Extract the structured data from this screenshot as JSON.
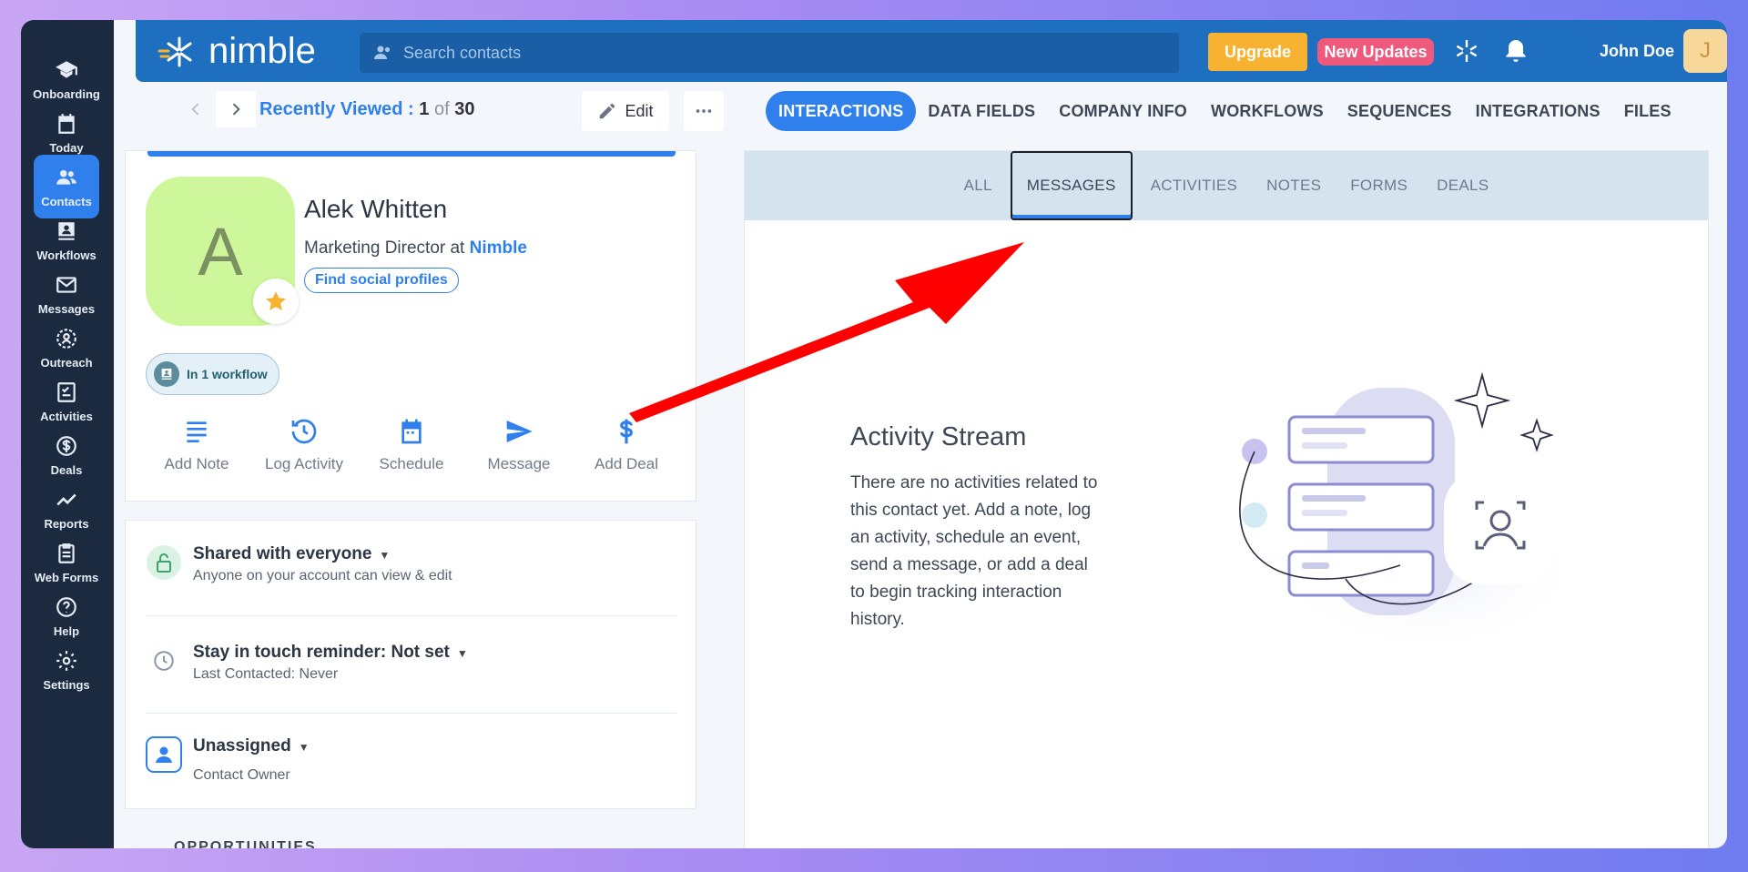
{
  "sidebar": {
    "items": [
      {
        "label": "Onboarding",
        "icon": "graduation-cap-icon"
      },
      {
        "label": "Today",
        "icon": "calendar-icon"
      },
      {
        "label": "Contacts",
        "icon": "people-icon",
        "active": true
      },
      {
        "label": "Workflows",
        "icon": "workflow-icon"
      },
      {
        "label": "Messages",
        "icon": "envelope-icon"
      },
      {
        "label": "Outreach",
        "icon": "outreach-icon"
      },
      {
        "label": "Activities",
        "icon": "checklist-icon"
      },
      {
        "label": "Deals",
        "icon": "dollar-circle-icon"
      },
      {
        "label": "Reports",
        "icon": "trend-icon"
      },
      {
        "label": "Web Forms",
        "icon": "clipboard-icon"
      },
      {
        "label": "Help",
        "icon": "question-icon"
      },
      {
        "label": "Settings",
        "icon": "gear-icon"
      }
    ]
  },
  "header": {
    "logo_text": "nimble",
    "search_placeholder": "Search contacts",
    "upgrade_label": "Upgrade",
    "updates_label": "New Updates",
    "user_name": "John Doe",
    "user_initial": "J"
  },
  "nav": {
    "recent_label": "Recently Viewed :",
    "current": "1",
    "of": "of",
    "total": "30",
    "edit_label": "Edit"
  },
  "main_tabs": [
    {
      "label": "INTERACTIONS",
      "active": true
    },
    {
      "label": "DATA FIELDS"
    },
    {
      "label": "COMPANY INFO"
    },
    {
      "label": "WORKFLOWS"
    },
    {
      "label": "SEQUENCES"
    },
    {
      "label": "INTEGRATIONS"
    },
    {
      "label": "FILES"
    }
  ],
  "contact": {
    "initial": "A",
    "name": "Alek Whitten",
    "title_prefix": "Marketing Director at",
    "company": "Nimble",
    "social_label": "Find social profiles",
    "workflow_label": "In 1 workflow"
  },
  "actions": [
    {
      "label": "Add Note",
      "icon": "note-lines-icon"
    },
    {
      "label": "Log Activity",
      "icon": "history-icon"
    },
    {
      "label": "Schedule",
      "icon": "calendar-icon"
    },
    {
      "label": "Message",
      "icon": "send-icon"
    },
    {
      "label": "Add Deal",
      "icon": "dollar-icon"
    }
  ],
  "info": {
    "shared_title": "Shared with everyone",
    "shared_sub": "Anyone on your account can view & edit",
    "reminder_title": "Stay in touch reminder: Not set",
    "reminder_sub": "Last Contacted: Never",
    "owner_title": "Unassigned",
    "owner_sub": "Contact Owner"
  },
  "opportunities_label": "OPPORTUNITIES",
  "sub_tabs": [
    {
      "label": "ALL"
    },
    {
      "label": "MESSAGES",
      "active": true
    },
    {
      "label": "ACTIVITIES"
    },
    {
      "label": "NOTES"
    },
    {
      "label": "FORMS"
    },
    {
      "label": "DEALS"
    }
  ],
  "stream": {
    "title": "Activity Stream",
    "text": "There are no activities related to this contact yet. Add a note, log an activity, schedule an event, send a message, or add a deal to begin tracking interaction history."
  },
  "colors": {
    "accent": "#2f80ed",
    "sidebar": "#1b2a3f",
    "topbar": "#1e6fc0",
    "upgrade": "#f8b231",
    "updates": "#ef5a7c",
    "annotation_arrow": "#ff0000"
  }
}
